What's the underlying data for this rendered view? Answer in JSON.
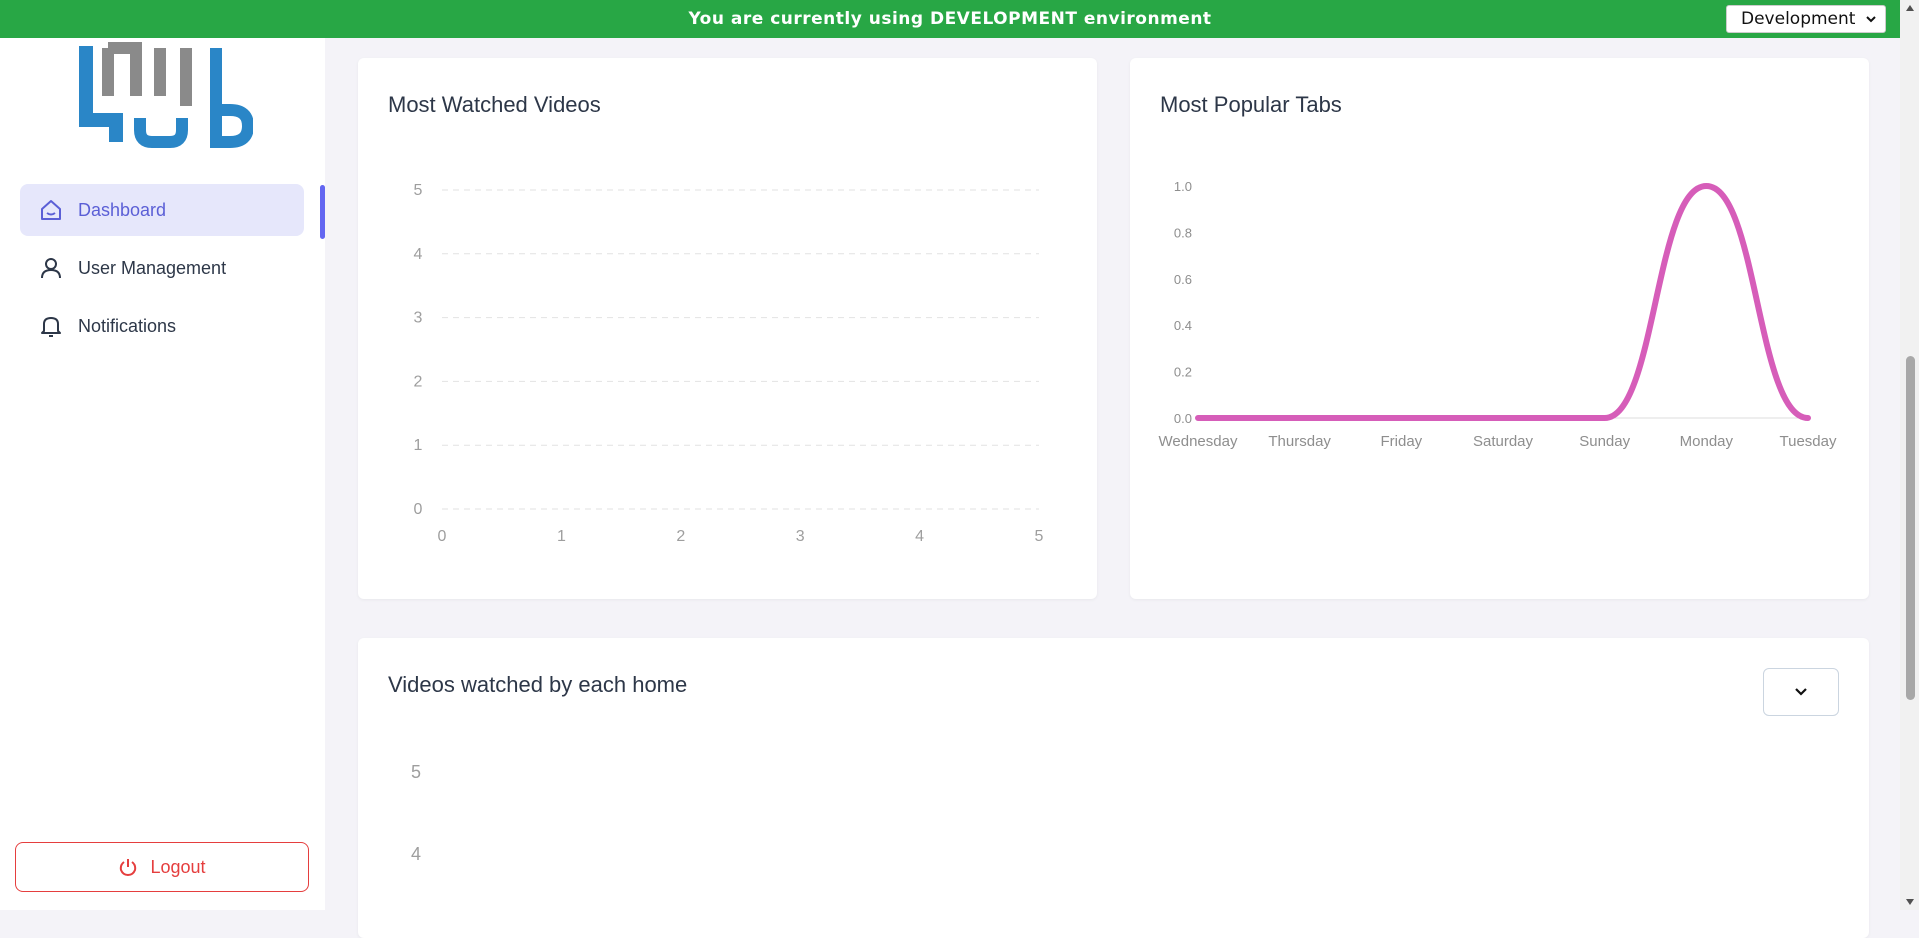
{
  "banner": {
    "text": "You are currently using DEVELOPMENT environment"
  },
  "environment": {
    "selected": "Development"
  },
  "sidebar": {
    "items": [
      {
        "label": "Dashboard",
        "icon": "home-icon",
        "active": true
      },
      {
        "label": "User Management",
        "icon": "user-icon",
        "active": false
      },
      {
        "label": "Notifications",
        "icon": "bell-icon",
        "active": false
      }
    ],
    "logout_label": "Logout"
  },
  "cards": {
    "most_watched": {
      "title": "Most Watched Videos"
    },
    "popular_tabs": {
      "title": "Most Popular Tabs"
    },
    "videos_by_home": {
      "title": "Videos watched by each home"
    }
  },
  "colors": {
    "banner": "#28a745",
    "accent": "#6366f1",
    "line": "#d65db9",
    "logout": "#e53e3e"
  },
  "chart_data": [
    {
      "type": "line",
      "title": "Most Watched Videos",
      "x": [
        0,
        1,
        2,
        3,
        4,
        5
      ],
      "y_ticks": [
        0,
        1,
        2,
        3,
        4,
        5
      ],
      "series": [],
      "xlim": [
        0,
        5
      ],
      "ylim": [
        0,
        5
      ],
      "grid": true
    },
    {
      "type": "line",
      "title": "Most Popular Tabs",
      "categories": [
        "Wednesday",
        "Thursday",
        "Friday",
        "Saturday",
        "Sunday",
        "Monday",
        "Tuesday"
      ],
      "y_ticks": [
        "0.0",
        "0.2",
        "0.4",
        "0.6",
        "0.8",
        "1.0"
      ],
      "series": [
        {
          "values": [
            0,
            0,
            0,
            0,
            0,
            1,
            0
          ]
        }
      ],
      "ylim": [
        0,
        1
      ],
      "grid": false
    },
    {
      "type": "bar",
      "title": "Videos watched by each home",
      "y_ticks": [
        4,
        5
      ],
      "series": []
    }
  ]
}
